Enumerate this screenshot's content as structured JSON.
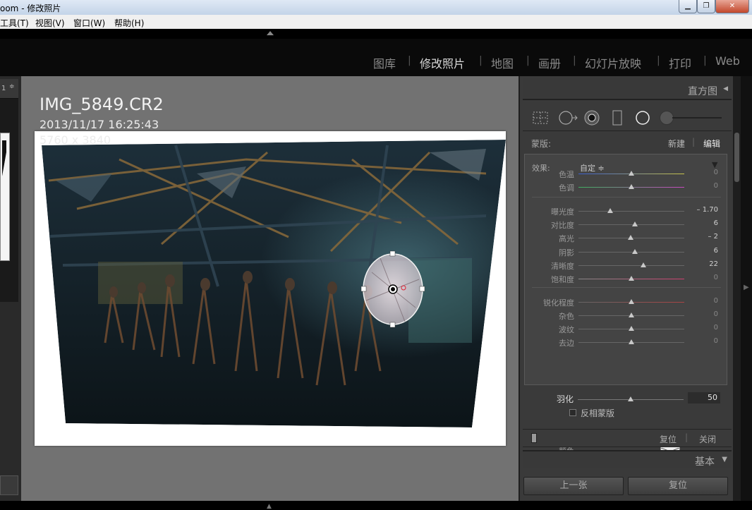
{
  "window": {
    "title": "oom - 修改照片",
    "controls": {
      "minimize": "▁",
      "maximize": "❐",
      "close": "✕"
    }
  },
  "menu": [
    "工具(T)",
    "视图(V)",
    "窗口(W)",
    "帮助(H)"
  ],
  "modules": [
    "图库",
    "修改照片",
    "地图",
    "画册",
    "幻灯片放映",
    "打印",
    "Web"
  ],
  "left_panel": {
    "top_number": "1",
    "top_arrows": "≑"
  },
  "image": {
    "name": "IMG_5849.CR2",
    "date": "2013/11/17 16:25:43",
    "dimensions": "5760 x 3840"
  },
  "histogram": {
    "label": "直方图",
    "caret": "◀"
  },
  "mask": {
    "label": "蒙版:",
    "new": "新建",
    "separator": "|",
    "edit": "编辑"
  },
  "effects": {
    "label": "效果:",
    "preset": "自定 ≑",
    "collapse": "▼",
    "sliders": [
      {
        "label": "色温",
        "value": "0",
        "pos": 0.5,
        "track": "temp"
      },
      {
        "label": "色调",
        "value": "0",
        "pos": 0.5,
        "track": "tint"
      },
      {
        "label": "曝光度",
        "value": "– 1.70",
        "pos": 0.3,
        "track": "plain"
      },
      {
        "label": "对比度",
        "value": "6",
        "pos": 0.53,
        "track": "plain"
      },
      {
        "label": "高光",
        "value": "– 2",
        "pos": 0.49,
        "track": "plain"
      },
      {
        "label": "阴影",
        "value": "6",
        "pos": 0.53,
        "track": "plain"
      },
      {
        "label": "清晰度",
        "value": "22",
        "pos": 0.61,
        "track": "plain"
      },
      {
        "label": "饱和度",
        "value": "0",
        "pos": 0.5,
        "track": "sat"
      },
      {
        "label": "锐化程度",
        "value": "0",
        "pos": 0.5,
        "track": "sharp"
      },
      {
        "label": "杂色",
        "value": "0",
        "pos": 0.5,
        "track": "plain"
      },
      {
        "label": "波纹",
        "value": "0",
        "pos": 0.5,
        "track": "plain"
      },
      {
        "label": "去边",
        "value": "0",
        "pos": 0.5,
        "track": "plain"
      }
    ],
    "color_label": "颜色"
  },
  "feather": {
    "label": "羽化",
    "value": "50",
    "pos": 0.5
  },
  "invert_label": "反相蒙版",
  "footer": {
    "reset": "复位",
    "separator": "|",
    "close": "关闭"
  },
  "basic": {
    "label": "基本",
    "caret": "▼"
  },
  "nav": {
    "prev": "上一张",
    "reset": "复位"
  },
  "colors": {
    "center_bg": "#727272",
    "panel_bg": "#3a3a3a",
    "active_module": "#d9d9d9"
  }
}
